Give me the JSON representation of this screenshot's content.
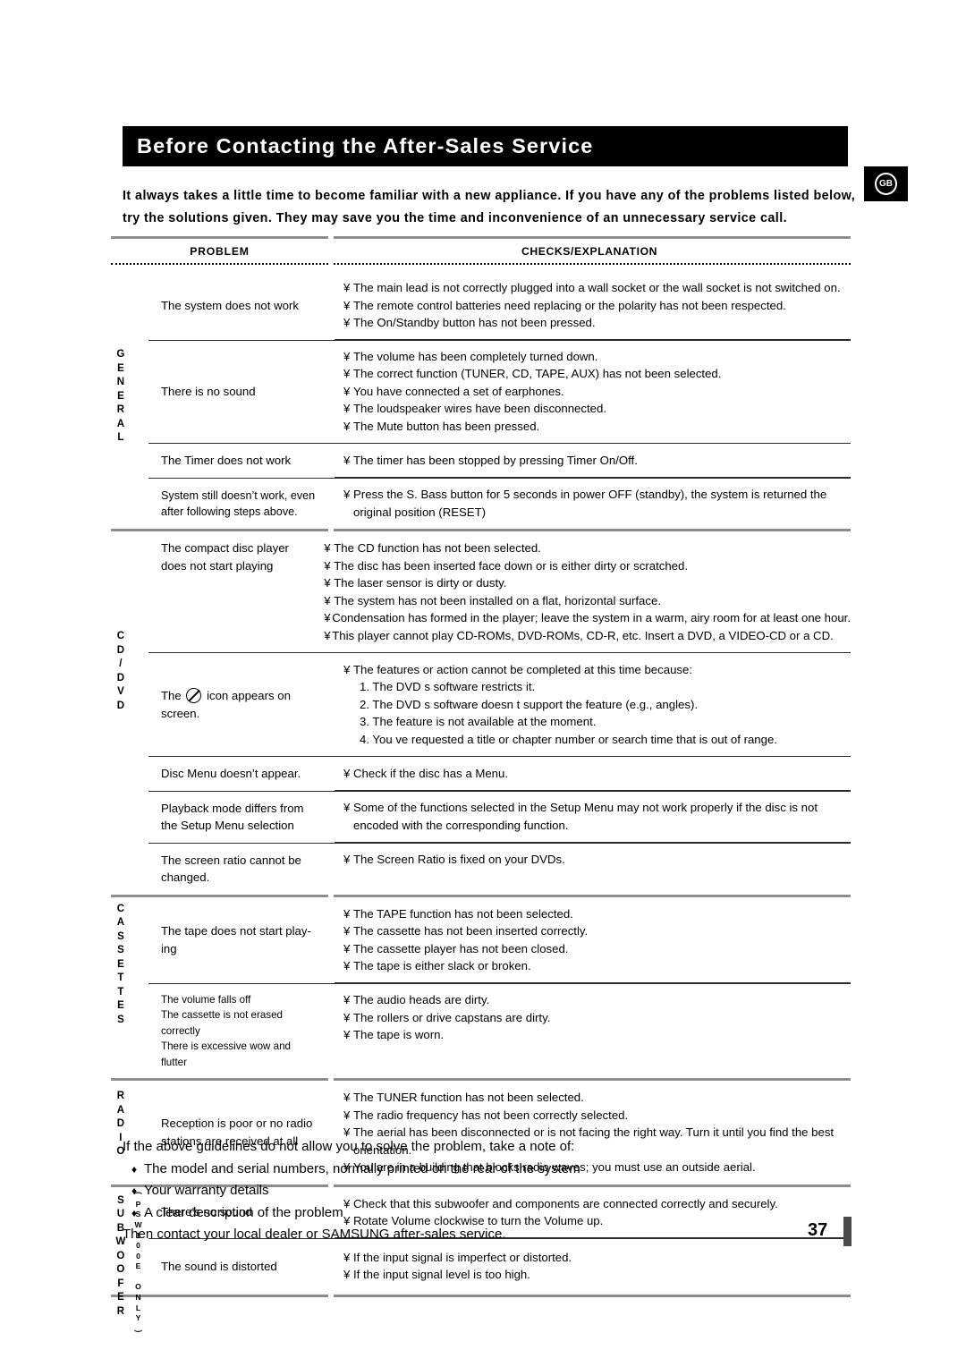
{
  "header": {
    "title": "Before Contacting the After-Sales Service",
    "region_badge": "GB",
    "intro_line1": "It always takes a little time to become familiar with a new appliance. If you have any of the problems listed below,",
    "intro_line2": "try the solutions given. They may save you the time and inconvenience of an unnecessary service call."
  },
  "table": {
    "columns": {
      "problem": "PROBLEM",
      "checks": "CHECKS/EXPLANATION"
    },
    "sections": [
      {
        "label": "GENERAL",
        "label_letters": "G\nE\nN\nE\nR\nA\nL",
        "rows": [
          {
            "problem": "The system does not work",
            "checks": [
              "The main lead is not correctly plugged into a wall socket or the wall socket is not switched on.",
              "The remote control batteries need replacing or the polarity has not been respected.",
              "The On/Standby  button has not been pressed."
            ]
          },
          {
            "problem": "There is no sound",
            "checks": [
              "The volume has been completely turned down.",
              "The correct function (TUNER, CD, TAPE, AUX) has not been selected.",
              "You have connected a set of earphones.",
              "The loudspeaker wires have been disconnected.",
              "The Mute  button has been pressed."
            ]
          },
          {
            "problem": "The Timer does not work",
            "checks": [
              "The timer has been stopped by pressing Timer On/Off."
            ]
          },
          {
            "problem": "System still doesn’t work, even after following steps above.",
            "checks": [
              "Press the S. Bass  button for 5 seconds in power  OFF (standby), the system is returned the",
              "original position (RESET)"
            ]
          }
        ]
      },
      {
        "label": "CD / DVD",
        "label_letters": "C\nD\n/\nD\nV\nD",
        "rows": [
          {
            "problem": "The compact disc player does not start playing",
            "checks": [
              "The CD function has not been selected.",
              "The disc has been inserted face down or is either dirty or scratched.",
              "The laser sensor is dirty or dusty.",
              "The system has not been installed on a flat, horizontal surface.",
              "Condensation has formed in the player; leave the system in a warm, airy room for at least one hour.",
              "This player cannot play CD-ROMs, DVD-ROMs, CD-R, etc. Insert a DVD, a VIDEO-CD or a CD."
            ]
          },
          {
            "problem_prefix": "The",
            "problem_icon": "prohibition-icon",
            "problem_suffix": "icon appears on screen.",
            "checks": [
              "The features or action cannot be completed at this time because:"
            ],
            "numbered": [
              "1. The DVD s software restricts it.",
              "2. The DVD s software doesn t support the feature (e.g., angles).",
              "3. The feature is not available at the moment.",
              "4. You ve requested a title or chapter number or search time that is out of range."
            ]
          },
          {
            "problem": "Disc Menu doesn’t appear.",
            "checks": [
              "Check if the disc has a Menu."
            ]
          },
          {
            "problem": "Playback mode differs from the Setup Menu selection",
            "checks": [
              "Some of the functions selected in the Setup Menu may not work properly if the disc is not",
              "encoded with the corresponding function."
            ]
          },
          {
            "problem": "The screen ratio cannot be changed.",
            "checks": [
              "The Screen Ratio is fixed on your DVDs."
            ]
          }
        ]
      },
      {
        "label": "CASSETTES",
        "label_letters": "C\nA\nS\nS\nE\nT\nT\nE\nS",
        "rows": [
          {
            "problem": "The tape does not start play-ing",
            "checks": [
              "The TAPE function has not been selected.",
              "The cassette has not been inserted correctly.",
              "The cassette player has not been closed.",
              "The tape is either slack or broken."
            ]
          },
          {
            "problem_lines": [
              "The volume falls off",
              "The cassette is not erased correctly",
              "There is excessive wow and flutter"
            ],
            "checks": [
              "The audio heads are dirty.",
              "The rollers or drive capstans are dirty.",
              "The tape is worn."
            ]
          }
        ]
      },
      {
        "label": "RADIO",
        "label_letters": "R\nA\nD\nI\nO",
        "rows": [
          {
            "problem": "Reception is poor or no radio stations are received at all",
            "checks": [
              "The TUNER function has not been selected.",
              "The radio frequency has not been correctly selected.",
              "The aerial has been disconnected or is not facing the right way. Turn it until you find the best",
              "orientation.",
              "You are in a building that blocks radio waves; you must use an outside aerial."
            ]
          }
        ]
      },
      {
        "label": "SUBWOOFER",
        "label_letters": "S\nU\nB\nW\nO\nO\nF\nE\nR",
        "sublabel_letters": "P\nS\nW\n1\n0\n0\nE\n \nO\nN\nL\nY",
        "rows": [
          {
            "problem": "There’s no sound",
            "checks": [
              "Check that this subwoofer and components are connected correctly and securely.",
              "Rotate Volume clockwise to turn the Volume up."
            ]
          },
          {
            "problem": "The sound is distorted",
            "checks": [
              "If the input signal is imperfect or distorted.",
              "If the input signal level is too high."
            ]
          }
        ]
      }
    ]
  },
  "footer": {
    "intro": "If the above guidelines do not allow you to solve the problem, take a note of:",
    "bullets": [
      "The model and serial numbers, normally printed on the rear of the system",
      "Your warranty details",
      "A clear description of the problem"
    ],
    "closing": "Then contact your local dealer or SAMSUNG after-sales service.",
    "bullet_glyph": "♦"
  },
  "page_number": "37",
  "bullet_glyph": "¥",
  "colors": {
    "header_bg": "#000000",
    "header_text": "#ffffff",
    "rule_gray": "#8c8c8c",
    "rule_dark": "#2b2b2b",
    "page_tab": "#4a4a4a"
  }
}
